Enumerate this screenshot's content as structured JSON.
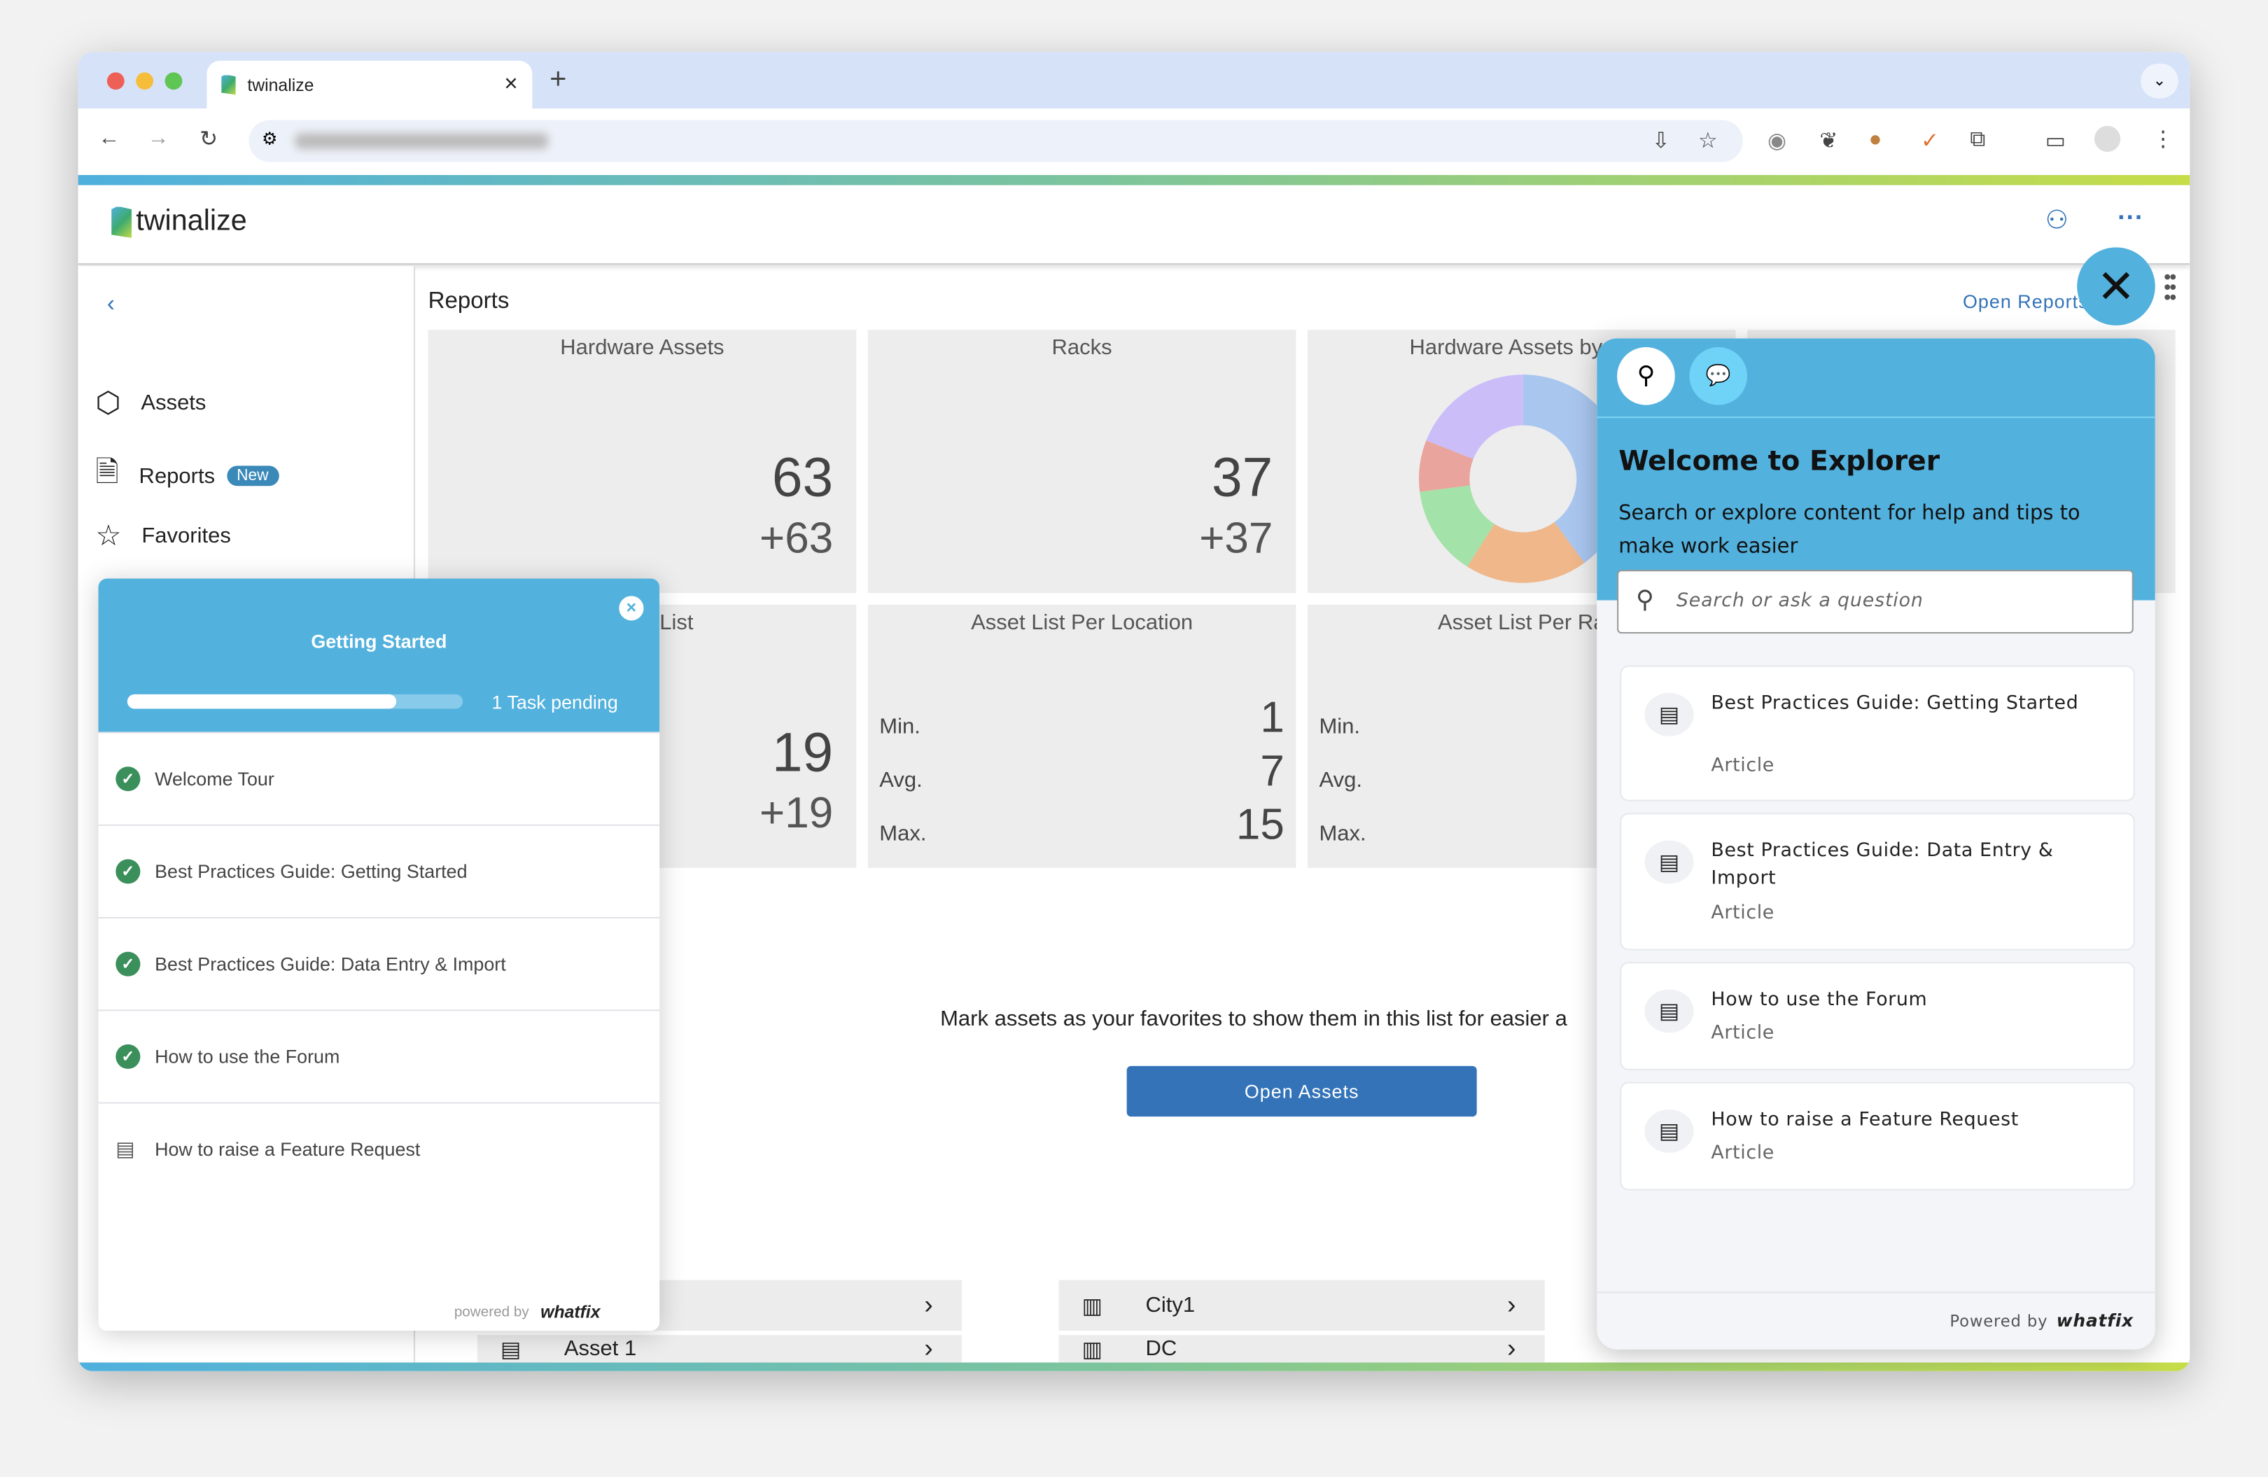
{
  "browser": {
    "tab_title": "twinalize",
    "new_tab": "+",
    "tab_close": "×",
    "url": "app.twinalize.com"
  },
  "app": {
    "logo": "twinalize"
  },
  "sidebar": {
    "items": [
      {
        "label": "Assets",
        "icon": "cube-icon"
      },
      {
        "label": "Reports",
        "icon": "report-icon",
        "badge": "New"
      },
      {
        "label": "Favorites",
        "icon": "star-icon"
      }
    ]
  },
  "main": {
    "title": "Reports",
    "open_reports": "Open Reports",
    "cards": [
      {
        "title": "Hardware Assets",
        "value": "63",
        "delta": "+63"
      },
      {
        "title": "Racks",
        "value": "37",
        "delta": "+37"
      },
      {
        "title": "Hardware Assets by Fu"
      },
      {
        "title": "List",
        "value": "19",
        "delta": "+19"
      },
      {
        "title": "Asset List Per Location",
        "min_label": "Min.",
        "min": "1",
        "avg_label": "Avg.",
        "avg": "7",
        "max_label": "Max.",
        "max": "15"
      },
      {
        "title": "Asset List Per Ra",
        "min_label": "Min.",
        "avg_label": "Avg.",
        "max_label": "Max."
      }
    ],
    "favorites_text": "Mark assets as your favorites to show them in this list for easier a",
    "open_assets": "Open Assets",
    "list_left": [
      "",
      "Asset 1"
    ],
    "list_right": [
      "City1",
      "DC"
    ]
  },
  "chart_data": {
    "type": "pie",
    "donut": true,
    "values": [
      0.4,
      0.19,
      0.14,
      0.08,
      0.19
    ],
    "colors": [
      "#a9c6ef",
      "#efb78a",
      "#a3e2a8",
      "#e9a49d",
      "#cbbdf8"
    ]
  },
  "getting_started": {
    "title": "Getting Started",
    "progress": 0.8,
    "pending": "1 Task pending",
    "items": [
      {
        "label": "Welcome Tour",
        "done": true
      },
      {
        "label": "Best Practices Guide: Getting Started",
        "done": true
      },
      {
        "label": "Best Practices Guide: Data Entry & Import",
        "done": true
      },
      {
        "label": "How to use the Forum",
        "done": true
      },
      {
        "label": "How to raise a Feature Request",
        "done": false
      }
    ],
    "powered_by": "powered by",
    "brand": "whatfix"
  },
  "explorer": {
    "title": "Welcome to Explorer",
    "description": "Search or explore content for help and tips to make work easier",
    "search_placeholder": "Search or ask a question",
    "items": [
      {
        "title": "Best Practices Guide: Getting Started",
        "type": "Article"
      },
      {
        "title": "Best Practices Guide: Data Entry & Import",
        "type": "Article"
      },
      {
        "title": "How to use the Forum",
        "type": "Article"
      },
      {
        "title": "How to raise a Feature Request",
        "type": "Article"
      }
    ],
    "powered_by": "Powered by",
    "brand": "whatfix",
    "accent": "#52b1dd"
  }
}
